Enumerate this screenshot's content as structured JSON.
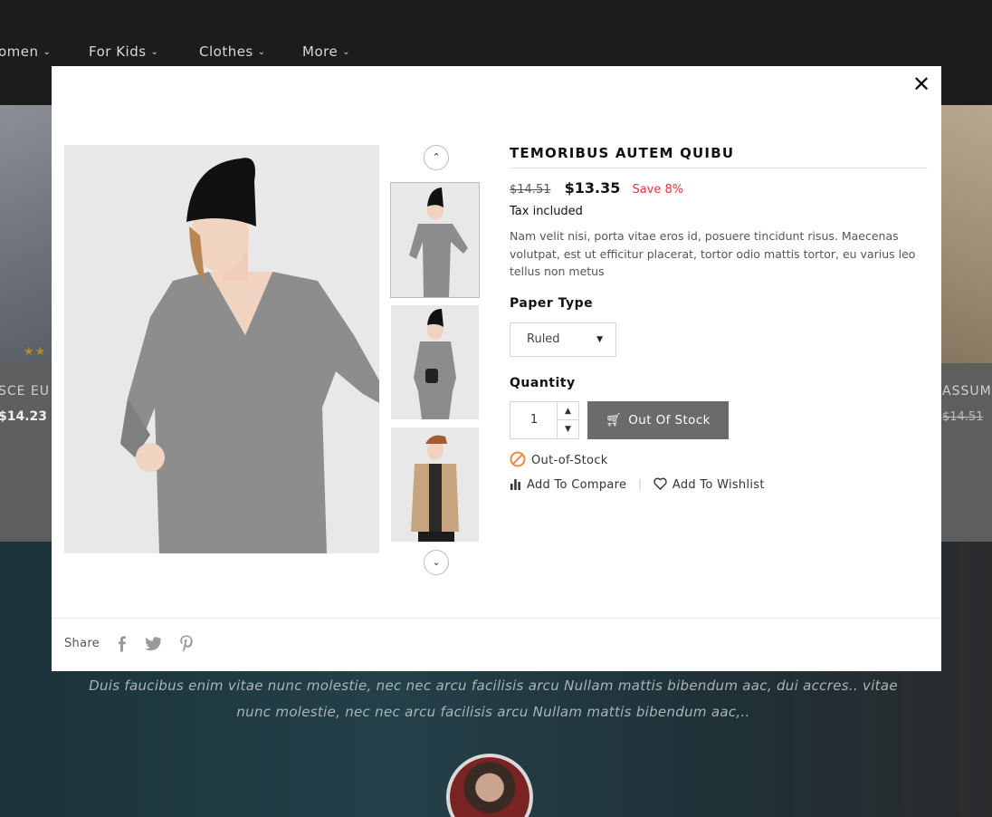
{
  "background": {
    "nav": [
      {
        "label": "omen"
      },
      {
        "label": "For Kids"
      },
      {
        "label": "Clothes"
      },
      {
        "label": "More"
      }
    ],
    "left_product": {
      "title": "SCE EU I",
      "price": "$14.23"
    },
    "right_product": {
      "title": "ASSUME",
      "price_old": "$14.51"
    },
    "testimonial": "Duis faucibus enim vitae nunc molestie, nec nec arcu facilisis arcu Nullam mattis bibendum aac, dui accres.. vitae nunc molestie, nec nec arcu facilisis arcu Nullam mattis bibendum aac,.."
  },
  "modal": {
    "close_icon": "close-icon",
    "product": {
      "name": "TEMORIBUS AUTEM QUIBU",
      "price_old": "$14.51",
      "price_new": "$13.35",
      "save": "Save 8%",
      "tax": "Tax included",
      "description": "Nam velit nisi, porta vitae eros id, posuere tincidunt risus. Maecenas volutpat, est ut efficitur placerat, tortor odio mattis tortor, eu varius leo tellus non metus"
    },
    "paper_type": {
      "label": "Paper Type",
      "selected": "Ruled"
    },
    "quantity": {
      "label": "Quantity",
      "value": "1"
    },
    "cart_button": "Out Of Stock",
    "stock_status": "Out-of-Stock",
    "compare": "Add To Compare",
    "wishlist": "Add To Wishlist",
    "share_label": "Share",
    "share_icons": [
      "facebook-icon",
      "twitter-icon",
      "pinterest-icon"
    ],
    "colors": {
      "save": "#e8343b",
      "stock_icon": "#f08a3c",
      "button": "#6b6b6b"
    }
  }
}
